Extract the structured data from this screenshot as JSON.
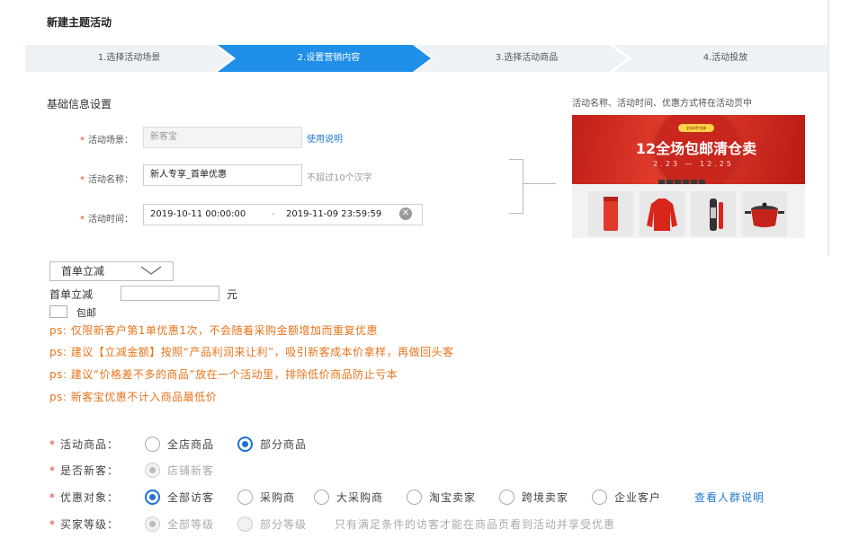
{
  "header": {
    "title": "新建主题活动"
  },
  "steps": [
    {
      "label": "1.选择活动场景",
      "active": false
    },
    {
      "label": "2.设置营销内容",
      "active": true
    },
    {
      "label": "3.选择活动商品",
      "active": false
    },
    {
      "label": "4.活动投放",
      "active": false
    }
  ],
  "basic_info": {
    "section_title": "基础信息设置",
    "scene": {
      "label": "活动场景：",
      "value": "新客宝",
      "link": "使用说明"
    },
    "name": {
      "label": "活动名称：",
      "value": "新人专享_首单优惠",
      "hint": "不超过10个汉字"
    },
    "time": {
      "label": "活动时间：",
      "start": "2019-10-11 00:00:00",
      "separator": "-",
      "end": "2019-11-09 23:59:59"
    }
  },
  "preview": {
    "note": "活动名称、活动时间、优惠方式将在活动页中",
    "banner_tag": "全场4件包邮",
    "banner_title": "12全场包邮清仓卖",
    "banner_date": "2.23 — 12.25",
    "products": [
      "battery-pack",
      "red-jacket",
      "bottle",
      "cooking-pot"
    ]
  },
  "discount": {
    "select_value": "首单立减",
    "amount_label": "首单立减",
    "amount_value": "",
    "unit": "元",
    "free_shipping_label": "包邮"
  },
  "notes": [
    "ps: 仅限新客户第1单优惠1次，不会随着采购金额增加而重复优惠",
    "ps: 建议【立减金额】按照“产品利润来让利”，吸引新客成本价拿样，再做回头客",
    "ps: 建议“价格差不多的商品”放在一个活动里，排除低价商品防止亏本",
    "ps: 新客宝优惠不计入商品最低价"
  ],
  "options": {
    "products": {
      "label": "活动商品：",
      "choices": [
        "全店商品",
        "部分商品"
      ],
      "selected": "部分商品"
    },
    "new_customer": {
      "label": "是否新客：",
      "choices": [
        "店铺新客"
      ],
      "selected": "店铺新客"
    },
    "target": {
      "label": "优惠对象：",
      "choices": [
        "全部访客",
        "采购商",
        "大采购商",
        "淘宝卖家",
        "跨境卖家",
        "企业客户"
      ],
      "selected": "全部访客",
      "link": "查看人群说明"
    },
    "buyer_level": {
      "label": "买家等级：",
      "choices": [
        "全部等级",
        "部分等级"
      ],
      "selected": "全部等级",
      "hint": "只有满足条件的访客才能在商品页看到活动并享受优惠"
    }
  },
  "colors": {
    "accent": "#1f8fe8",
    "note": "#e8741c",
    "required": "#e63c2e",
    "link": "#1f78d1",
    "banner": "#d52b22"
  }
}
